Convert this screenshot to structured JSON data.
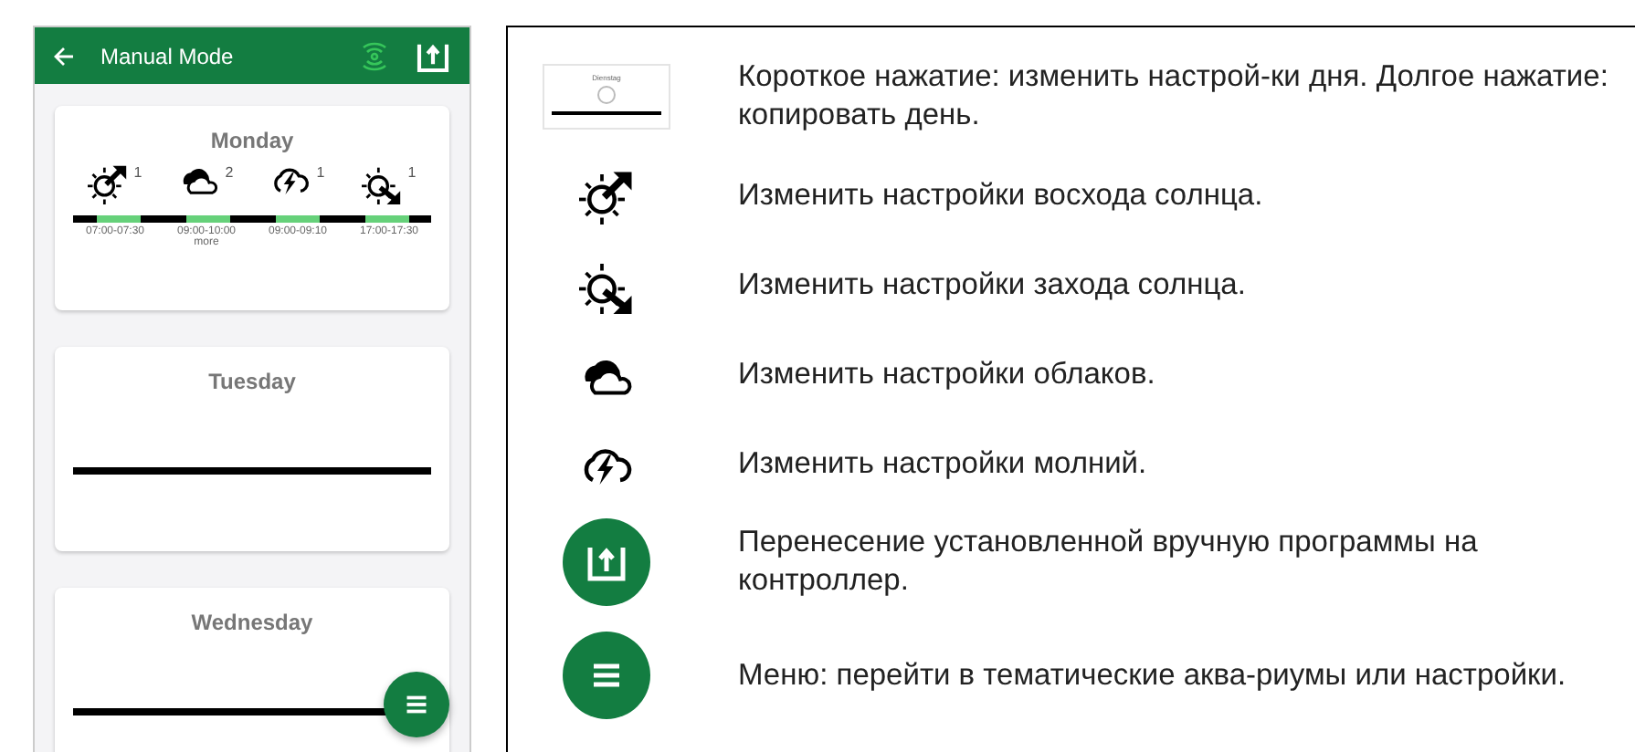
{
  "app": {
    "title": "Manual Mode"
  },
  "days": [
    {
      "name": "Monday",
      "events": [
        {
          "kind": "sunrise",
          "count": "1",
          "time": "07:00-07:30"
        },
        {
          "kind": "cloud",
          "count": "2",
          "time": "09:00-10:00",
          "note": "more"
        },
        {
          "kind": "storm",
          "count": "1",
          "time": "09:00-09:10"
        },
        {
          "kind": "sunset",
          "count": "1",
          "time": "17:00-17:30"
        }
      ]
    },
    {
      "name": "Tuesday"
    },
    {
      "name": "Wednesday"
    }
  ],
  "legend": [
    {
      "kind": "thumbnail",
      "thumb_label": "Dienstag",
      "text": "Короткое нажатие: изменить настрой-ки дня. Долгое нажатие: копировать день."
    },
    {
      "kind": "sunrise",
      "text": "Изменить настройки восхода солнца."
    },
    {
      "kind": "sunset",
      "text": "Изменить настройки захода солнца."
    },
    {
      "kind": "cloud",
      "text": "Изменить настройки облаков."
    },
    {
      "kind": "storm",
      "text": "Изменить настройки молний."
    },
    {
      "kind": "upload",
      "text": "Перенесение установленной вручную программы на контроллер."
    },
    {
      "kind": "menu",
      "text": "Меню: перейти в тематические аква-риумы или настройки."
    }
  ]
}
